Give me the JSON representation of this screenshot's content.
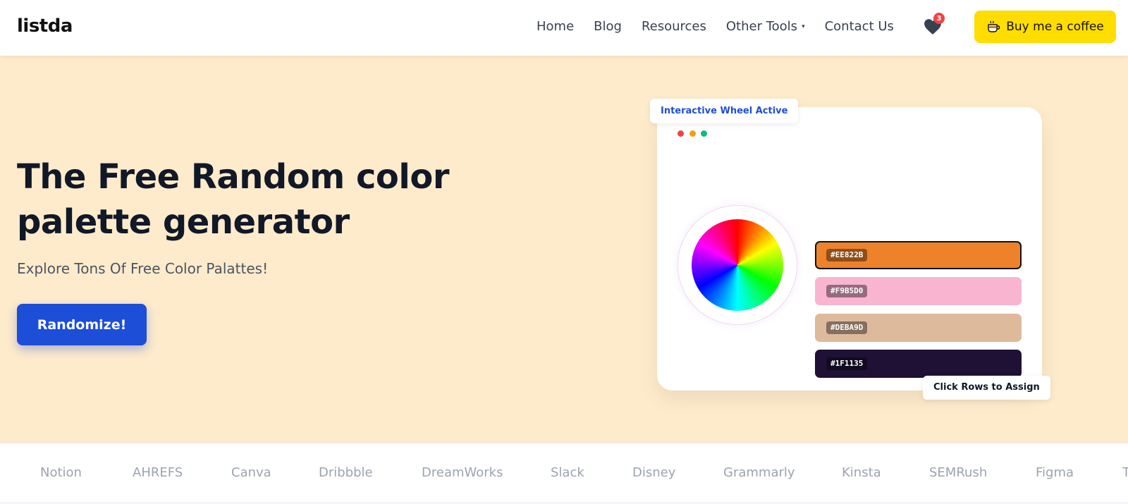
{
  "header": {
    "logo": "listda",
    "nav": [
      {
        "label": "Home"
      },
      {
        "label": "Blog"
      },
      {
        "label": "Resources"
      },
      {
        "label": "Other Tools",
        "has_dropdown": true
      },
      {
        "label": "Contact Us"
      }
    ],
    "favorites_count": "3",
    "coffee_label": "Buy me a coffee",
    "coffee_color": "#ffdd00"
  },
  "hero": {
    "title": "The Free Random color palette generator",
    "subtitle": "Explore Tons Of Free Color Palattes!",
    "button_label": "Randomize!",
    "background": "#feebcb",
    "button_color": "#1d4ed8"
  },
  "preview": {
    "badge_top": "Interactive Wheel Active",
    "badge_bottom": "Click Rows to Assign",
    "swatches": [
      {
        "hex": "#EE822B",
        "active": true
      },
      {
        "hex": "#F9B5D0",
        "active": false
      },
      {
        "hex": "#DEBA9D",
        "active": false
      },
      {
        "hex": "#1F1135",
        "active": false
      }
    ]
  },
  "brands": [
    "Notion",
    "AHREFS",
    "Canva",
    "Dribbble",
    "DreamWorks",
    "Slack",
    "Disney",
    "Grammarly",
    "Kinsta",
    "SEMRush",
    "Figma",
    "T"
  ]
}
